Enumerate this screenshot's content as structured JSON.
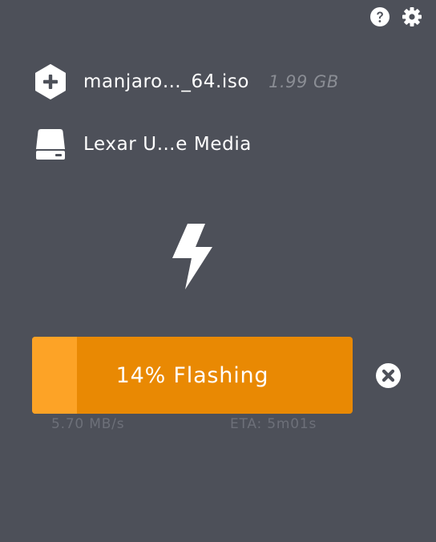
{
  "header": {
    "help_icon": "help-circle-icon",
    "settings_icon": "gear-icon"
  },
  "image": {
    "icon": "add-hexagon-icon",
    "name": "manjaro…_64.iso",
    "size": "1.99 GB"
  },
  "drive": {
    "icon": "drive-icon",
    "name": "Lexar U…e Media"
  },
  "flash": {
    "icon": "lightning-bolt-icon"
  },
  "progress": {
    "percent": 14,
    "label": "14% Flashing",
    "speed": "5.70 MB/s",
    "eta": "ETA: 5m01s",
    "cancel_icon": "close-circle-icon"
  },
  "colors": {
    "background": "#4d5059",
    "progress_track": "#e98903",
    "progress_fill": "#fda326",
    "icon": "#ffffff",
    "muted_text": "#8a8d94"
  }
}
